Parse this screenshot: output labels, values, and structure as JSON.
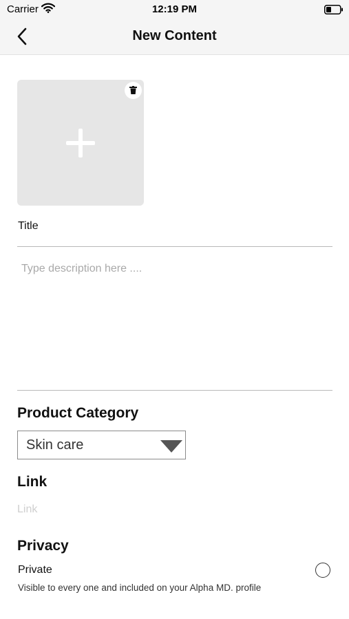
{
  "status_bar": {
    "carrier": "Carrier",
    "time": "12:19 PM"
  },
  "nav": {
    "title": "New Content"
  },
  "form": {
    "title_label": "Title",
    "description_placeholder": "Type description here ....",
    "category_heading": "Product Category",
    "category_value": "Skin care",
    "link_heading": "Link",
    "link_placeholder": "Link",
    "privacy_heading": "Privacy",
    "private_label": "Private",
    "private_description": "Visible to every one and included on your Alpha MD. profile",
    "private_selected": false
  },
  "icons": {
    "back": "chevron-left-icon",
    "add_image": "plus-icon",
    "delete": "trash-icon",
    "wifi": "wifi-icon",
    "battery": "battery-icon",
    "dropdown": "triangle-down-icon"
  },
  "colors": {
    "placeholder_box": "#e6e6e6",
    "bar_background": "#f5f5f5"
  }
}
